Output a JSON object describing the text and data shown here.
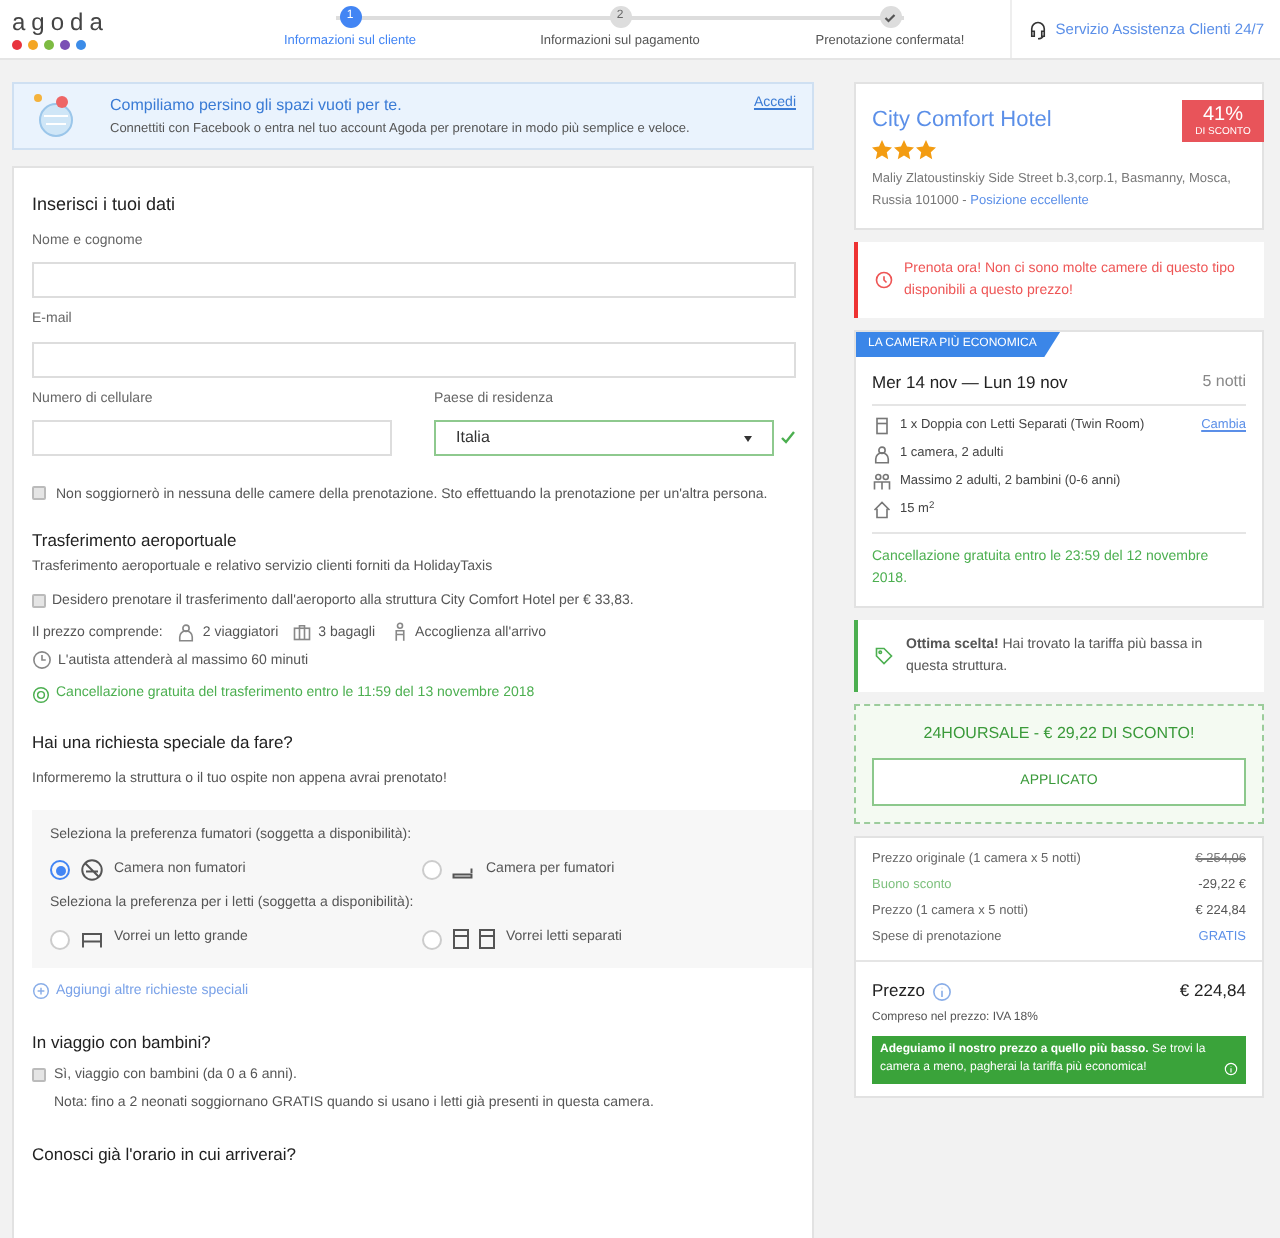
{
  "header": {
    "logo": "agoda",
    "logo_dots": [
      {
        "color": "#e8333d"
      },
      {
        "color": "#f4a623"
      },
      {
        "color": "#7dbb42"
      },
      {
        "color": "#7b4fb5"
      },
      {
        "color": "#3c8ce8"
      }
    ],
    "steps": [
      {
        "kind": "number",
        "number": "1",
        "label": "Informazioni sul cliente",
        "selected": true
      },
      {
        "kind": "number",
        "number": "2",
        "label": "Informazioni sul pagamento",
        "selected": false
      },
      {
        "kind": "check",
        "label": "Prenotazione confermata!",
        "selected": false
      }
    ],
    "support_link": "Servizio Assistenza Clienti 24/7"
  },
  "banner": {
    "title": "Compiliamo persino gli spazi vuoti per te.",
    "text": "Connettiti con Facebook o entra nel tuo account Agoda per prenotare in modo più semplice e veloce.",
    "link": "Accedi"
  },
  "form": {
    "heading": "Inserisci i tuoi dati",
    "fields": [
      {
        "label": "Nome e cognome",
        "kind": "text"
      },
      {
        "label": "E-mail",
        "kind": "text"
      },
      {
        "label": "Numero di cellulare",
        "kind": "text"
      },
      {
        "label": "Paese di residenza",
        "kind": "select",
        "value": "Italia",
        "valid": true
      }
    ],
    "other_guest": {
      "text": "Non soggiornerò in nessuna delle camere della prenotazione. Sto effettuando la prenotazione per un'altra persona.",
      "checked": false
    }
  },
  "transfer": {
    "title": "Trasferimento aeroportuale",
    "subtitle": "Trasferimento aeroportuale e relativo servizio clienti forniti da HolidayTaxis",
    "checkbox": {
      "text": "Desidero prenotare il trasferimento dall'aeroporto alla struttura City Comfort Hotel per € 33,83.",
      "checked": false
    },
    "includes_label": "Il prezzo comprende:",
    "includes": [
      {
        "kind": "person",
        "text": "2 viaggiatori"
      },
      {
        "kind": "luggage",
        "text": "3 bagagli"
      },
      {
        "kind": "greeter",
        "text": "Accoglienza all'arrivo"
      },
      {
        "kind": "clock",
        "text": "L'autista attenderà al massimo 60 minuti"
      }
    ],
    "cancellation": "Cancellazione gratuita del trasferimento entro le 11:59 del 13 novembre 2018"
  },
  "special_requests": {
    "title": "Hai una richiesta speciale da fare?",
    "subtitle": "Informeremo la struttura o il tuo ospite non appena avrai prenotato!",
    "groups": [
      {
        "label": "Seleziona la preferenza fumatori (soggetta a disponibilità):",
        "options": [
          {
            "kind": "no-smoking",
            "label": "Camera non fumatori",
            "selected": true
          },
          {
            "kind": "smoking",
            "label": "Camera per fumatori",
            "selected": false
          }
        ]
      },
      {
        "label": "Seleziona la preferenza per i letti (soggetta a disponibilità):",
        "options": [
          {
            "kind": "double-bed",
            "label": "Vorrei un letto grande",
            "selected": false
          },
          {
            "kind": "twin-beds",
            "label": "Vorrei letti separati",
            "selected": false
          }
        ]
      }
    ],
    "add_link": "Aggiungi altre richieste speciali"
  },
  "children": {
    "title": "In viaggio con bambini?",
    "checkbox": {
      "text": "Sì, viaggio con bambini (da 0 a 6 anni).",
      "checked": false
    },
    "note": "Nota: fino a 2 neonati soggiornano GRATIS quando si usano i letti già presenti in questa camera."
  },
  "arrival": {
    "title": "Conosci già l'orario in cui arriverai?"
  },
  "hotel": {
    "name": "City Comfort Hotel",
    "stars": 3,
    "address": "Maliy Zlatoustinskiy Side Street b.3,corp.1, Basmanny, Mosca, Russia 101000 -",
    "location_link": "Posizione eccellente",
    "discount": "41%",
    "discount_label": "DI SCONTO"
  },
  "urgency": "Prenota ora! Non ci sono molte camere di questo tipo disponibili a questo prezzo!",
  "room": {
    "ribbon": "LA CAMERA PIÙ ECONOMICA",
    "dates": "Mer 14 nov — Lun 19 nov",
    "nights": "5 notti",
    "details": [
      {
        "kind": "bed",
        "text": "1 x Doppia con Letti Separati (Twin Room)",
        "link": "Cambia"
      },
      {
        "kind": "person",
        "text": "1 camera, 2 adulti"
      },
      {
        "kind": "group",
        "text": "Massimo 2 adulti, 2 bambini (0-6 anni)"
      },
      {
        "kind": "house",
        "text": "15 m$^{2}$"
      }
    ],
    "cancellation": "Cancellazione gratuita entro le 23:59 del 12 novembre 2018."
  },
  "tip": "**Ottima scelta!** Hai trovato la tariffa più bassa in questa struttura.",
  "promo": {
    "title": "24HOURSALE - € 29,22 DI SCONTO!",
    "button": "APPLICATO"
  },
  "price": {
    "lines": [
      {
        "kind": "original",
        "label": "Prezzo originale (1 camera x 5 notti)",
        "value": "€ 254,06"
      },
      {
        "kind": "discount",
        "label": "Buono sconto",
        "value": "-29,22 €"
      },
      {
        "kind": "normal",
        "label": "Prezzo (1 camera x 5 notti)",
        "value": "€ 224,84"
      },
      {
        "kind": "free",
        "label": "Spese di prenotazione",
        "value": "GRATIS"
      }
    ],
    "total_label": "Prezzo",
    "total": "€ 224,84",
    "tax": "Compreso nel prezzo: IVA 18%",
    "price_match": "**Adeguiamo il nostro prezzo a quello più basso.** Se trovi la camera a meno, pagherai la tariffa più economica!"
  }
}
